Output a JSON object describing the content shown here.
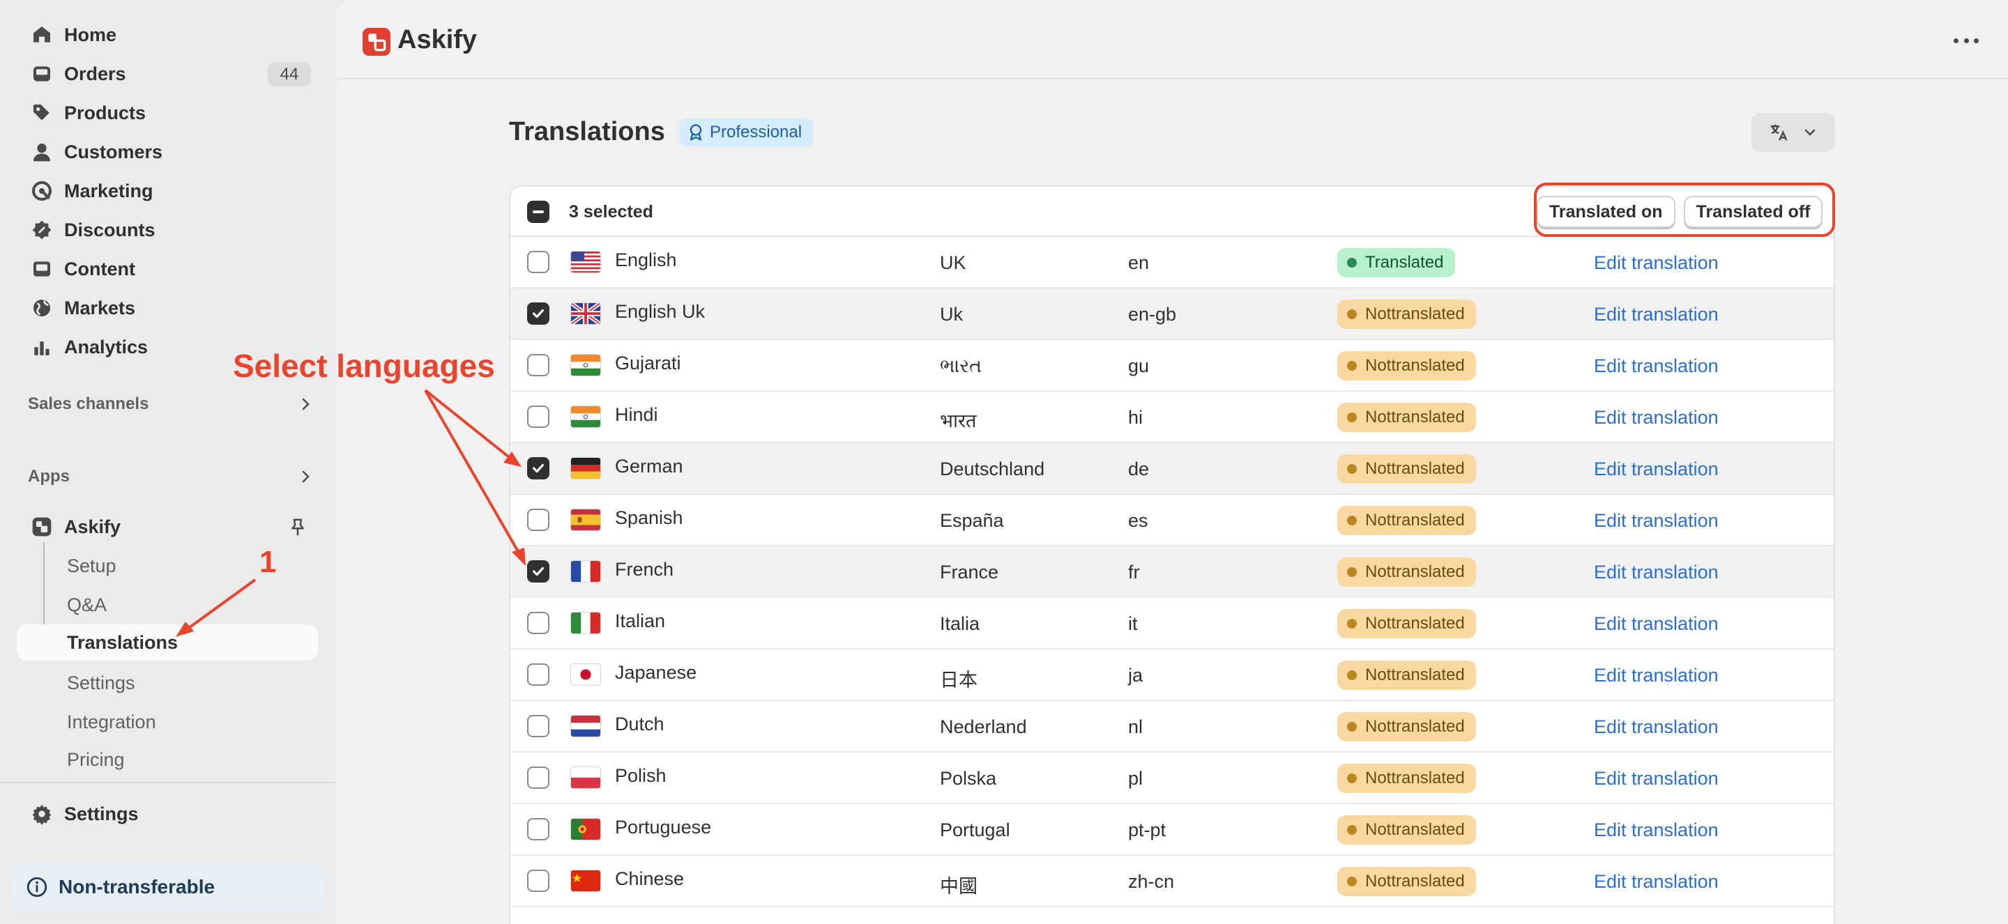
{
  "sidebar": {
    "nav": [
      {
        "label": "Home",
        "icon": "home-icon"
      },
      {
        "label": "Orders",
        "icon": "inbox-icon",
        "badge": "44"
      },
      {
        "label": "Products",
        "icon": "tag-icon"
      },
      {
        "label": "Customers",
        "icon": "person-icon"
      },
      {
        "label": "Marketing",
        "icon": "target-icon"
      },
      {
        "label": "Discounts",
        "icon": "discount-icon"
      },
      {
        "label": "Content",
        "icon": "image-icon"
      },
      {
        "label": "Markets",
        "icon": "globe-icon"
      },
      {
        "label": "Analytics",
        "icon": "bar-chart-icon"
      }
    ],
    "sales_channels": "Sales channels",
    "apps": "Apps",
    "app_name": "Askify",
    "app_subitems": [
      "Setup",
      "Q&A",
      "Translations",
      "Settings",
      "Integration",
      "Pricing"
    ],
    "active_subitem": "Translations",
    "settings": "Settings",
    "notice": "Non-transferable"
  },
  "topbar": {
    "app_title": "Askify"
  },
  "page": {
    "title": "Translations",
    "plan_badge": "Professional"
  },
  "table": {
    "selected_label": "3 selected",
    "actions": [
      "Translated on",
      "Translated off"
    ],
    "rows": [
      {
        "name": "English",
        "region": "UK",
        "code": "en",
        "status": "Translated",
        "link": "Edit translation",
        "checked": false,
        "flag": "us"
      },
      {
        "name": "English Uk",
        "region": "Uk",
        "code": "en-gb",
        "status": "Nottranslated",
        "link": "Edit translation",
        "checked": true,
        "flag": "gb"
      },
      {
        "name": "Gujarati",
        "region": "ભારત",
        "code": "gu",
        "status": "Nottranslated",
        "link": "Edit translation",
        "checked": false,
        "flag": "in"
      },
      {
        "name": "Hindi",
        "region": "भारत",
        "code": "hi",
        "status": "Nottranslated",
        "link": "Edit translation",
        "checked": false,
        "flag": "in"
      },
      {
        "name": "German",
        "region": "Deutschland",
        "code": "de",
        "status": "Nottranslated",
        "link": "Edit translation",
        "checked": true,
        "flag": "de"
      },
      {
        "name": "Spanish",
        "region": "España",
        "code": "es",
        "status": "Nottranslated",
        "link": "Edit translation",
        "checked": false,
        "flag": "es"
      },
      {
        "name": "French",
        "region": "France",
        "code": "fr",
        "status": "Nottranslated",
        "link": "Edit translation",
        "checked": true,
        "flag": "fr"
      },
      {
        "name": "Italian",
        "region": "Italia",
        "code": "it",
        "status": "Nottranslated",
        "link": "Edit translation",
        "checked": false,
        "flag": "it"
      },
      {
        "name": "Japanese",
        "region": "日本",
        "code": "ja",
        "status": "Nottranslated",
        "link": "Edit translation",
        "checked": false,
        "flag": "jp"
      },
      {
        "name": "Dutch",
        "region": "Nederland",
        "code": "nl",
        "status": "Nottranslated",
        "link": "Edit translation",
        "checked": false,
        "flag": "nl"
      },
      {
        "name": "Polish",
        "region": "Polska",
        "code": "pl",
        "status": "Nottranslated",
        "link": "Edit translation",
        "checked": false,
        "flag": "pl"
      },
      {
        "name": "Portuguese",
        "region": "Portugal",
        "code": "pt-pt",
        "status": "Nottranslated",
        "link": "Edit translation",
        "checked": false,
        "flag": "pt"
      },
      {
        "name": "Chinese",
        "region": "中國",
        "code": "zh-cn",
        "status": "Nottranslated",
        "link": "Edit translation",
        "checked": false,
        "flag": "cn"
      }
    ]
  },
  "annotations": {
    "select_languages": "Select languages",
    "step_number": "1"
  },
  "colors": {
    "accent_red": "#e8442e",
    "link_blue": "#2c6ecb",
    "translated_bg": "#b7f2cd",
    "not_translated_bg": "#fbd8a2"
  }
}
